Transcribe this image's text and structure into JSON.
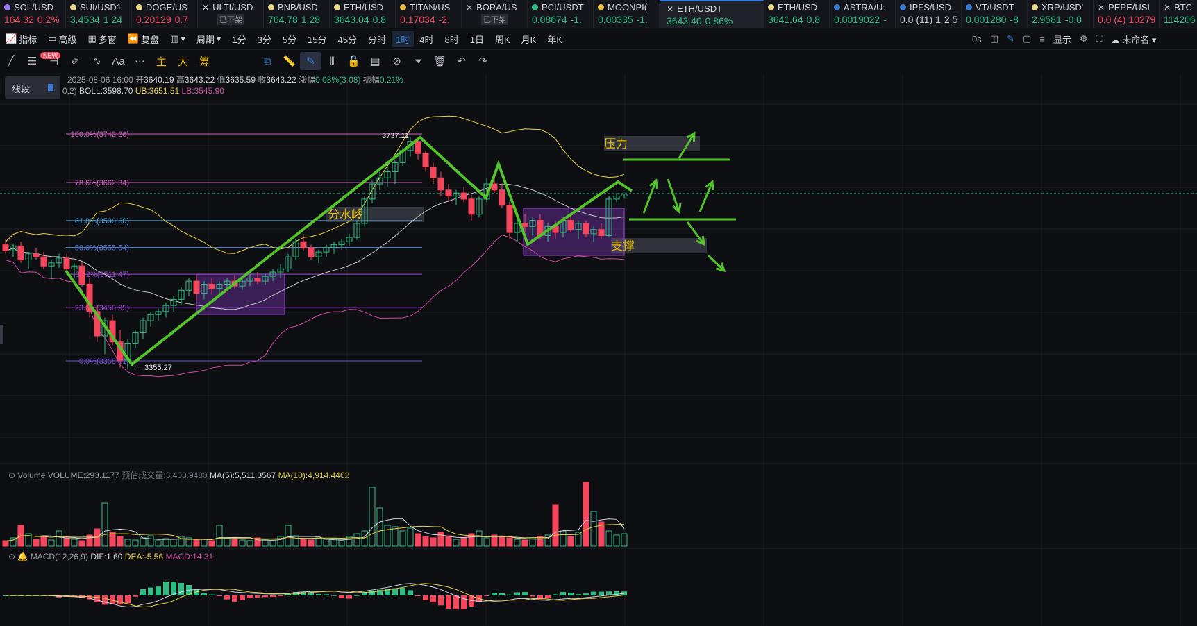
{
  "tabs": [
    {
      "symbol": "SOL/USD",
      "price": "164.32",
      "change": "0.2%",
      "dir": "dn",
      "dot": "#9a7bff"
    },
    {
      "symbol": "SUI/USD1",
      "price": "3.4534",
      "change": "1.24",
      "dir": "up",
      "dot": "#e8d88a"
    },
    {
      "symbol": "DOGE/US",
      "price": "0.20129",
      "change": "0.7",
      "dir": "dn",
      "dot": "#e8d88a"
    },
    {
      "symbol": "ULTI/USD",
      "price": "",
      "change": "",
      "dir": "up",
      "dot": "",
      "delisted": "已下架",
      "x": true
    },
    {
      "symbol": "BNB/USD",
      "price": "764.78",
      "change": "1.28",
      "dir": "up",
      "dot": "#e8d88a"
    },
    {
      "symbol": "ETH/USD",
      "price": "3643.04",
      "change": "0.8",
      "dir": "up",
      "dot": "#e8d88a"
    },
    {
      "symbol": "TITAN/US",
      "price": "0.17034",
      "change": "-2.",
      "dir": "dn",
      "dot": "#e8c040"
    },
    {
      "symbol": "BORA/US",
      "price": "",
      "change": "",
      "dir": "up",
      "dot": "",
      "delisted": "已下架",
      "x": true
    },
    {
      "symbol": "PCI/USDT",
      "price": "0.08674",
      "change": "-1.",
      "dir": "up",
      "dot": "#2ebd85"
    },
    {
      "symbol": "MOONPI(",
      "price": "0.00335",
      "change": "-1.",
      "dir": "up",
      "dot": "#e8c040"
    },
    {
      "symbol": "ETH/USDT",
      "price": "3643.40",
      "change": "0.86%",
      "dir": "up",
      "dot": "",
      "x": true,
      "active": true
    },
    {
      "symbol": "ETH/USD",
      "price": "3641.64",
      "change": "0.8",
      "dir": "up",
      "dot": "#e8d88a"
    },
    {
      "symbol": "ASTRA/U:",
      "price": "0.0019022",
      "change": "-",
      "dir": "up",
      "dot": "#3a7bd5"
    },
    {
      "symbol": "IPFS/USD",
      "price": "0.0 (11) 1",
      "change": "2.5",
      "dir": "wh",
      "dot": "#3a7bd5"
    },
    {
      "symbol": "VT/USDT",
      "price": "0.001280",
      "change": "-8",
      "dir": "up",
      "dot": "#3a7bd5"
    },
    {
      "symbol": "XRP/USD'",
      "price": "2.9581",
      "change": "-0.0",
      "dir": "up",
      "dot": "#e8d88a"
    },
    {
      "symbol": "PEPE/USI",
      "price": "0.0 (4) 10279",
      "change": "",
      "dir": "dn",
      "dot": "",
      "x": true
    },
    {
      "symbol": "BTC",
      "price": "114206",
      "change": "",
      "dir": "up",
      "dot": "",
      "x": true
    }
  ],
  "toolbar": {
    "indicators": "指标",
    "new_badge": "NEW",
    "advanced": "高级",
    "multi": "多窗",
    "replay": "复盘",
    "period": "周期",
    "intervals": [
      "1分",
      "3分",
      "5分",
      "15分",
      "45分",
      "分时",
      "1时",
      "4时",
      "8时",
      "1日",
      "周K",
      "月K",
      "年K"
    ],
    "selected_interval": "1时",
    "seconds": "0s",
    "display": "显示",
    "unnamed": "未命名"
  },
  "drawbar": {
    "main": "主",
    "big": "大",
    "chip": "筹"
  },
  "line_panel": "线段",
  "info": {
    "datetime": "2025-08-06 16:00",
    "open_label": "开",
    "open": "3640.19",
    "high_label": "高",
    "high": "3643.22",
    "low_label": "低",
    "low": "3635.59",
    "close_label": "收",
    "close": "3643.22",
    "change_label": "涨幅",
    "change": "0.08%(3.08)",
    "amp_label": "振幅",
    "amp": "0.21%",
    "boll_params": "0,2)",
    "boll": "BOLL:3598.70",
    "ub": "UB:3651.51",
    "lb": "LB:3545.90"
  },
  "fib": [
    {
      "label": "100.0%(3742.26)",
      "color": "#d05cc0"
    },
    {
      "label": "78.6%(3662.34)",
      "color": "#d05cc0"
    },
    {
      "label": "61.8%(3599.60)",
      "color": "#4aa3df"
    },
    {
      "label": "50.0%(3555.54)",
      "color": "#4a7bdf"
    },
    {
      "label": "38.2%(3511.47)",
      "color": "#9a4ad0"
    },
    {
      "label": "23.6%(3456.95)",
      "color": "#9a4ad0"
    },
    {
      "label": "0.0%(3368.81)",
      "color": "#6a4ad0"
    }
  ],
  "annotations": {
    "high": "3737.11",
    "low": "3355.27",
    "divide": "分水岭",
    "pressure": "压力",
    "support": "支撑"
  },
  "volume": {
    "title": "Volume",
    "vol": "VOLUME:293.1177",
    "est": "预估成交量:3,403.9480",
    "ma5": "MA(5):5,511.3567",
    "ma10": "MA(10):4,914.4402"
  },
  "macd": {
    "title": "MACD(12,26,9)",
    "dif": "DIF:1.60",
    "dea": "DEA:-5.56",
    "macd": "MACD:14.31"
  },
  "colors": {
    "up": "#2ebd85",
    "down": "#f6465d",
    "accent": "#3a7bd5",
    "trend": "#53c22b",
    "boll_mid": "#c8c8c8",
    "boll_up": "#e6d24a",
    "boll_low": "#d04aa0"
  },
  "chart_data": {
    "type": "candlestick",
    "ohlc": [
      [
        3560,
        3570,
        3545,
        3550
      ],
      [
        3550,
        3562,
        3540,
        3558
      ],
      [
        3558,
        3565,
        3530,
        3535
      ],
      [
        3535,
        3548,
        3520,
        3545
      ],
      [
        3545,
        3555,
        3535,
        3540
      ],
      [
        3540,
        3548,
        3520,
        3525
      ],
      [
        3525,
        3535,
        3505,
        3530
      ],
      [
        3530,
        3545,
        3522,
        3538
      ],
      [
        3538,
        3545,
        3518,
        3520
      ],
      [
        3520,
        3530,
        3505,
        3525
      ],
      [
        3525,
        3532,
        3490,
        3495
      ],
      [
        3495,
        3505,
        3440,
        3450
      ],
      [
        3450,
        3460,
        3400,
        3410
      ],
      [
        3410,
        3440,
        3380,
        3435
      ],
      [
        3435,
        3445,
        3395,
        3400
      ],
      [
        3400,
        3420,
        3358,
        3370
      ],
      [
        3370,
        3405,
        3355,
        3398
      ],
      [
        3398,
        3420,
        3390,
        3415
      ],
      [
        3415,
        3440,
        3405,
        3435
      ],
      [
        3435,
        3450,
        3425,
        3445
      ],
      [
        3445,
        3455,
        3435,
        3450
      ],
      [
        3450,
        3465,
        3440,
        3460
      ],
      [
        3460,
        3475,
        3450,
        3470
      ],
      [
        3470,
        3490,
        3460,
        3485
      ],
      [
        3485,
        3505,
        3475,
        3500
      ],
      [
        3500,
        3510,
        3470,
        3480
      ],
      [
        3480,
        3500,
        3470,
        3495
      ],
      [
        3495,
        3505,
        3478,
        3488
      ],
      [
        3488,
        3500,
        3478,
        3495
      ],
      [
        3495,
        3505,
        3485,
        3500
      ],
      [
        3500,
        3510,
        3488,
        3492
      ],
      [
        3492,
        3505,
        3485,
        3500
      ],
      [
        3500,
        3512,
        3492,
        3505
      ],
      [
        3505,
        3515,
        3495,
        3500
      ],
      [
        3500,
        3512,
        3494,
        3508
      ],
      [
        3508,
        3520,
        3500,
        3515
      ],
      [
        3515,
        3528,
        3505,
        3520
      ],
      [
        3520,
        3545,
        3515,
        3540
      ],
      [
        3540,
        3570,
        3535,
        3565
      ],
      [
        3565,
        3575,
        3550,
        3555
      ],
      [
        3555,
        3560,
        3535,
        3540
      ],
      [
        3540,
        3552,
        3530,
        3548
      ],
      [
        3548,
        3560,
        3540,
        3555
      ],
      [
        3555,
        3565,
        3545,
        3560
      ],
      [
        3560,
        3570,
        3552,
        3565
      ],
      [
        3565,
        3578,
        3558,
        3572
      ],
      [
        3572,
        3600,
        3568,
        3595
      ],
      [
        3595,
        3640,
        3590,
        3635
      ],
      [
        3635,
        3665,
        3628,
        3660
      ],
      [
        3660,
        3680,
        3650,
        3670
      ],
      [
        3670,
        3690,
        3655,
        3680
      ],
      [
        3680,
        3700,
        3660,
        3695
      ],
      [
        3695,
        3720,
        3690,
        3715
      ],
      [
        3715,
        3737,
        3705,
        3730
      ],
      [
        3730,
        3737,
        3700,
        3710
      ],
      [
        3710,
        3715,
        3680,
        3688
      ],
      [
        3688,
        3695,
        3660,
        3670
      ],
      [
        3670,
        3680,
        3640,
        3650
      ],
      [
        3650,
        3660,
        3630,
        3640
      ],
      [
        3640,
        3650,
        3625,
        3645
      ],
      [
        3645,
        3655,
        3630,
        3635
      ],
      [
        3635,
        3642,
        3600,
        3610
      ],
      [
        3610,
        3640,
        3605,
        3635
      ],
      [
        3635,
        3670,
        3630,
        3660
      ],
      [
        3660,
        3675,
        3645,
        3650
      ],
      [
        3650,
        3660,
        3620,
        3625
      ],
      [
        3625,
        3630,
        3570,
        3580
      ],
      [
        3580,
        3600,
        3565,
        3595
      ],
      [
        3595,
        3610,
        3580,
        3590
      ],
      [
        3590,
        3605,
        3575,
        3600
      ],
      [
        3600,
        3610,
        3570,
        3575
      ],
      [
        3575,
        3595,
        3565,
        3590
      ],
      [
        3590,
        3600,
        3570,
        3580
      ],
      [
        3580,
        3605,
        3572,
        3600
      ],
      [
        3600,
        3610,
        3580,
        3585
      ],
      [
        3585,
        3600,
        3570,
        3595
      ],
      [
        3595,
        3600,
        3572,
        3578
      ],
      [
        3578,
        3590,
        3565,
        3585
      ],
      [
        3585,
        3595,
        3570,
        3575
      ],
      [
        3575,
        3640,
        3572,
        3635
      ],
      [
        3635,
        3645,
        3630,
        3640
      ],
      [
        3640,
        3643.22,
        3635.59,
        3643.22
      ]
    ],
    "boll": {
      "mid_start": 3540,
      "mid_end": 3598.7,
      "ub_end": 3651.51,
      "lb_end": 3545.9
    },
    "yrange": [
      3300,
      3800
    ]
  }
}
